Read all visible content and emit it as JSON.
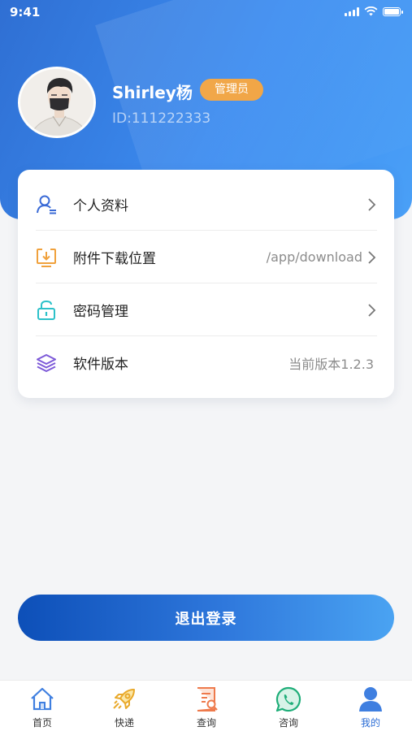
{
  "status_bar": {
    "time": "9:41"
  },
  "profile": {
    "name": "Shirley杨",
    "role_badge": "管理员",
    "user_id": "ID:111222333"
  },
  "menu": {
    "items": [
      {
        "label": "个人资料",
        "value": "",
        "icon": "user-profile-icon"
      },
      {
        "label": "附件下载位置",
        "value": "/app/download",
        "icon": "download-tray-icon"
      },
      {
        "label": "密码管理",
        "value": "",
        "icon": "lock-icon"
      },
      {
        "label": "软件版本",
        "value": "当前版本1.2.3",
        "icon": "layers-icon"
      }
    ]
  },
  "logout_label": "退出登录",
  "tabs": [
    {
      "label": "首页",
      "icon": "home-icon"
    },
    {
      "label": "快递",
      "icon": "rocket-icon"
    },
    {
      "label": "查询",
      "icon": "document-search-icon"
    },
    {
      "label": "咨询",
      "icon": "whatsapp-chat-icon"
    },
    {
      "label": "我的",
      "icon": "user-icon",
      "active": true
    }
  ],
  "colors": {
    "primary": "#2f6fd3",
    "badge": "#f0a13c",
    "profile_icon": "#3a6ad6",
    "download_icon": "#f0a13c",
    "lock_icon": "#2cc1c9",
    "layers_icon": "#7d5ad8"
  }
}
